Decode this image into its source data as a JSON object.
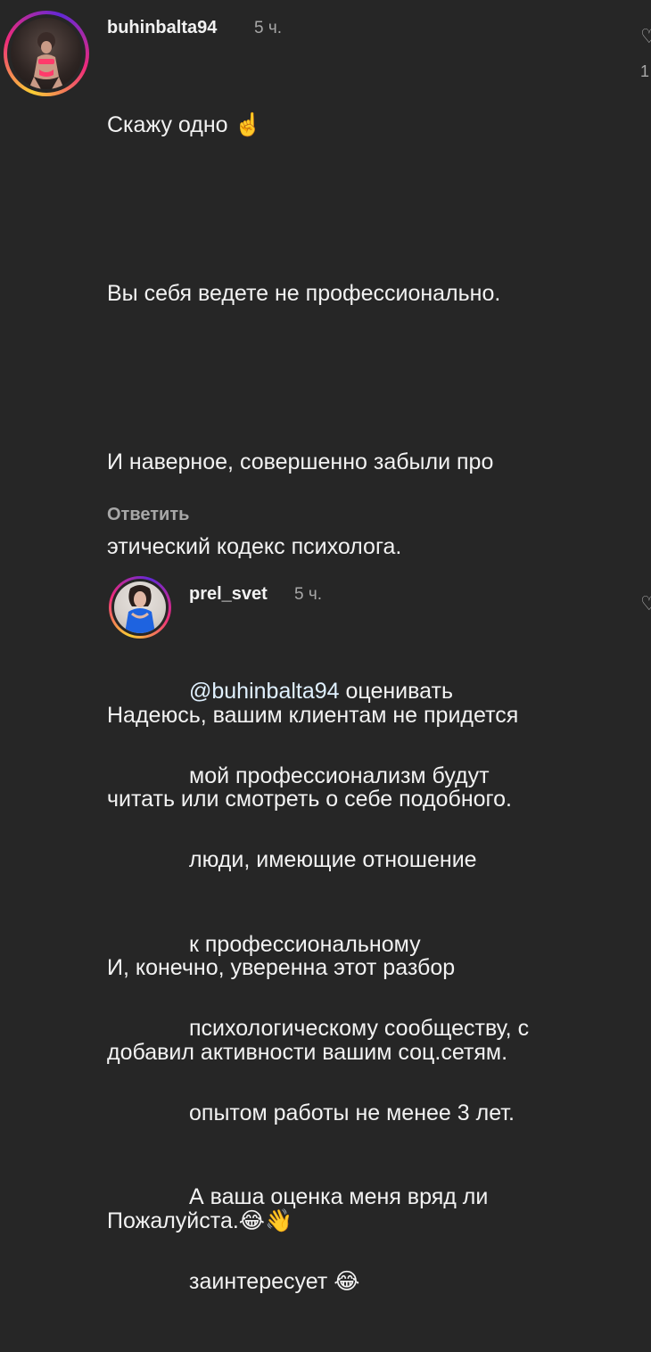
{
  "comments": [
    {
      "username": "buhinbalta94",
      "time": "5 ч.",
      "lines": [
        "Скажу одно ☝️",
        "",
        "Вы себя ведете не профессионально.",
        "",
        "И наверное, совершенно забыли про",
        "этический кодекс психолога.",
        "",
        "Надеюсь, вашим клиентам не придется",
        "читать или смотреть о себе подобного.",
        "",
        "И, конечно, уверенна этот разбор",
        "добавил активности вашим соц.сетям.",
        "",
        "Пожалуйста.😂👋"
      ],
      "reply_label": "Ответить",
      "like_count": "1",
      "avatar_icon": "user-avatar"
    },
    {
      "username": "prel_svet",
      "time": "5 ч.",
      "mention": "@buhinbalta94",
      "lines": [
        " оценивать",
        "мой профессионализм будут",
        "люди, имеющие отношение",
        "к профессиональному",
        "психологическому сообществу, с",
        "опытом работы не менее 3 лет.",
        "А ваша оценка меня вряд ли",
        "заинтересует 😂"
      ],
      "avatar_icon": "user-avatar"
    }
  ]
}
